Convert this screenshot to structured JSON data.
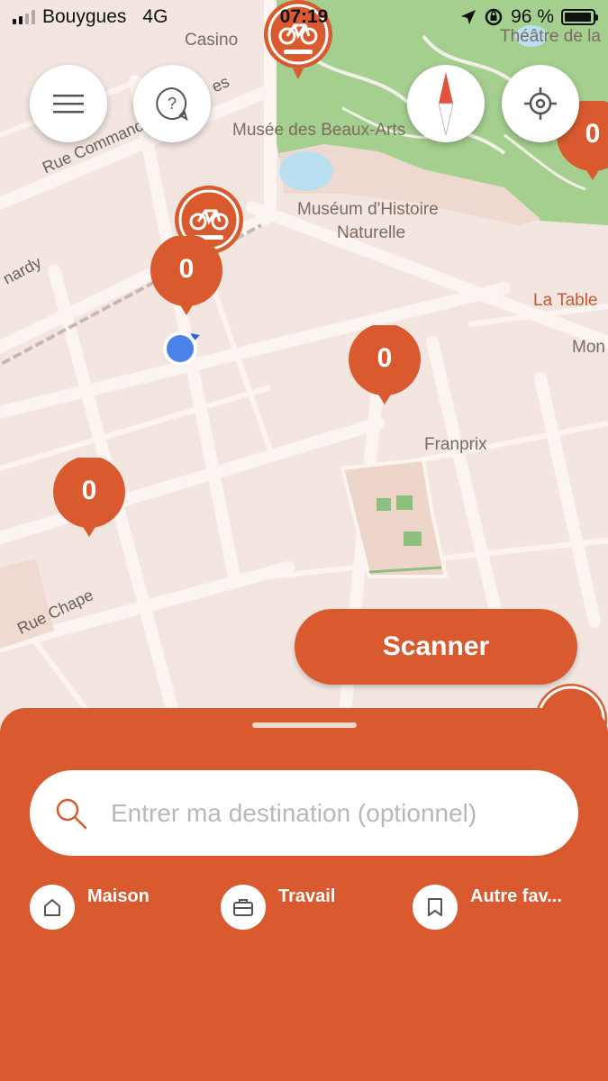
{
  "status_bar": {
    "carrier": "Bouygues",
    "network": "4G",
    "time": "07:19",
    "battery": "96 %",
    "battery_level": 0.96
  },
  "map": {
    "labels": {
      "casino": "Casino",
      "theatre": "Théâtre de la",
      "musee": "Musée des Beaux-Arts",
      "museum_line1": "Muséum d'Histoire",
      "museum_line2": "Naturelle",
      "rue_command": "Rue Commandant",
      "rue_cut": "es",
      "rue_ardy": "nardy",
      "la_table": "La Table",
      "mon": "Mon",
      "franprix": "Franprix",
      "rue_chape": "Rue Chape"
    },
    "markers": {
      "m1": "0",
      "m2": "0",
      "m3": "0",
      "m4": "0",
      "m_edge": "0"
    }
  },
  "buttons": {
    "scanner": "Scanner"
  },
  "search": {
    "placeholder": "Entrer ma destination (optionnel)"
  },
  "favorites": {
    "home": "Maison",
    "work": "Travail",
    "other": "Autre fav..."
  },
  "colors": {
    "brand": "#d95a2e",
    "park": "#8fbf7f"
  }
}
